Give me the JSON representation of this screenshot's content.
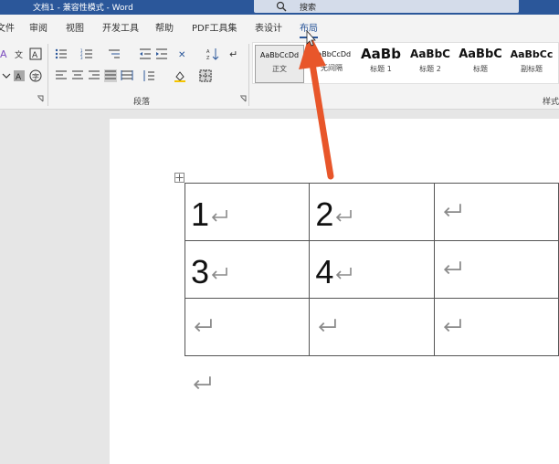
{
  "titlebar": {
    "title": "文档1 - 兼容性模式 - Word",
    "search_placeholder": "搜索"
  },
  "tabs": [
    {
      "label": "文件"
    },
    {
      "label": "审阅"
    },
    {
      "label": "视图"
    },
    {
      "label": "开发工具"
    },
    {
      "label": "帮助"
    },
    {
      "label": "PDF工具集"
    },
    {
      "label": "表设计"
    },
    {
      "label": "布局",
      "active": true
    }
  ],
  "ribbon": {
    "paragraph_group_label": "段落",
    "styles_group_label": "样式",
    "styles": [
      {
        "sample": "AaBbCcDd",
        "name": "正文",
        "selected": true
      },
      {
        "sample": "AaBbCcDd",
        "name": "无间隔"
      },
      {
        "sample": "AaBb",
        "name": "标题 1"
      },
      {
        "sample": "AaBbC",
        "name": "标题 2"
      },
      {
        "sample": "AaBbC",
        "name": "标题"
      },
      {
        "sample": "AaBbCc",
        "name": "副标题"
      }
    ]
  },
  "document": {
    "table": [
      [
        "1",
        "2",
        ""
      ],
      [
        "3",
        "4",
        ""
      ],
      [
        "",
        "",
        ""
      ]
    ]
  },
  "colors": {
    "titlebar": "#2b579a",
    "arrow": "#e8562a"
  }
}
